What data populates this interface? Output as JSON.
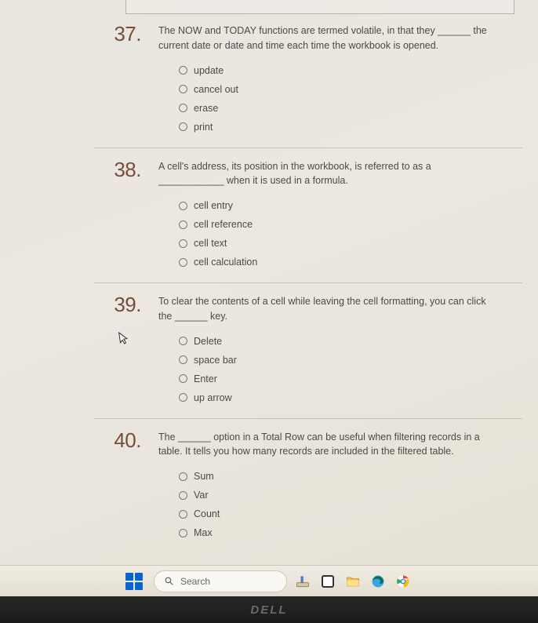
{
  "questions": [
    {
      "number": "37.",
      "prompt": "The NOW and TODAY functions are termed volatile, in that they ______ the current date or date and time each time the workbook is opened.",
      "options": [
        "update",
        "cancel out",
        "erase",
        "print"
      ]
    },
    {
      "number": "38.",
      "prompt": "A cell's address, its position in the workbook, is referred to as a ____________ when it is used in a formula.",
      "options": [
        "cell entry",
        "cell reference",
        "cell text",
        "cell calculation"
      ]
    },
    {
      "number": "39.",
      "prompt": "To clear the contents of a cell while leaving the cell formatting, you can click the ______ key.",
      "options": [
        "Delete",
        "space bar",
        "Enter",
        "up arrow"
      ]
    },
    {
      "number": "40.",
      "prompt": "The ______ option in a Total Row can be useful when filtering records in a table. It tells you how many records are included in the filtered table.",
      "options": [
        "Sum",
        "Var",
        "Count",
        "Max"
      ]
    }
  ],
  "taskbar": {
    "search_placeholder": "Search"
  },
  "brand": "DELL"
}
